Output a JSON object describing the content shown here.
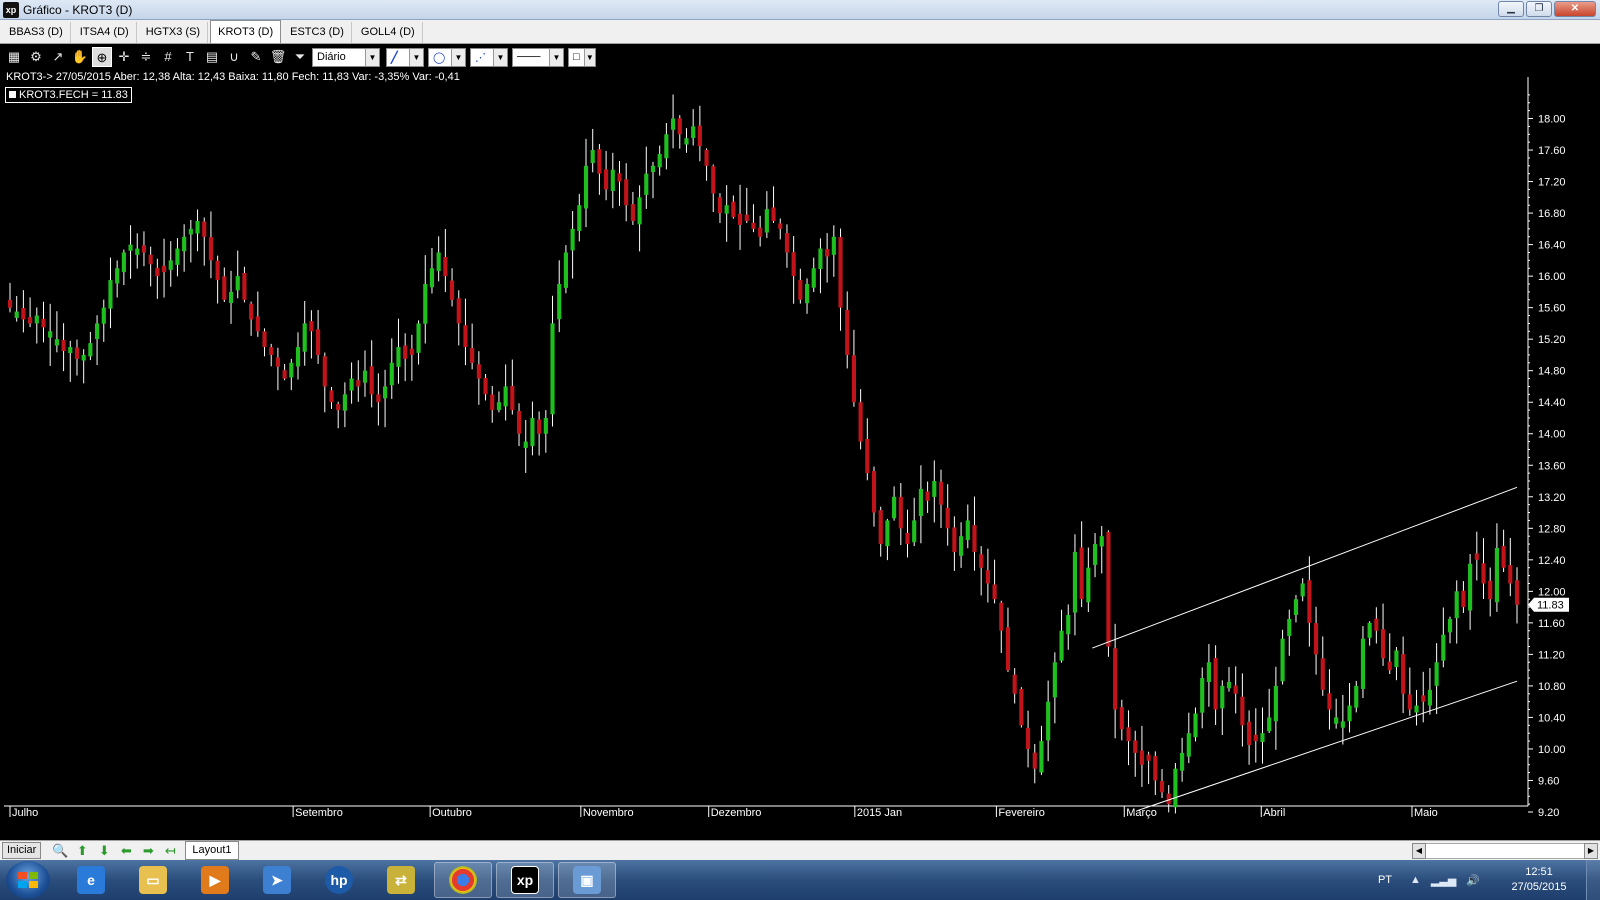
{
  "window": {
    "app_icon": "xp",
    "title": "Gráfico - KROT3 (D)"
  },
  "tabs": [
    "BBAS3 (D)",
    "ITSA4 (D)",
    "HGTX3 (S)",
    "KROT3 (D)",
    "ESTC3 (D)",
    "GOLL4 (D)"
  ],
  "active_tab": "KROT3 (D)",
  "toolbar": {
    "period": "Diário"
  },
  "info_line": "KROT3-> 27/05/2015 Aber: 12,38 Alta: 12,43 Baixa: 11,80 Fech: 11,83 Var: -3,35% Var: -0,41",
  "legend": "KROT3.FECH = 11.83",
  "bottom": {
    "start_label": "Iniciar",
    "layout_tab": "Layout1"
  },
  "taskbar": {
    "language": "PT",
    "time": "12:51",
    "date": "27/05/2015"
  },
  "colors": {
    "up": "#1fbf1f",
    "down": "#c0141a",
    "background": "#000000",
    "text": "#ffffff"
  },
  "chart_data": {
    "type": "candlestick",
    "symbol": "KROT3",
    "last_price": "11.83",
    "ylim": [
      9.2,
      18.4
    ],
    "y_ticks": [
      "18.00",
      "17.60",
      "17.20",
      "16.80",
      "16.40",
      "16.00",
      "15.60",
      "15.20",
      "14.80",
      "14.40",
      "14.00",
      "13.60",
      "13.20",
      "12.80",
      "12.40",
      "12.00",
      "11.60",
      "11.20",
      "10.80",
      "10.40",
      "10.00",
      "9.60",
      "9.20"
    ],
    "month_labels": [
      {
        "label": "Julho",
        "date": "2014-07-01"
      },
      {
        "label": "Setembro",
        "date": "2014-09-01"
      },
      {
        "label": "Outubro",
        "date": "2014-10-01"
      },
      {
        "label": "Novembro",
        "date": "2014-11-03"
      },
      {
        "label": "Dezembro",
        "date": "2014-12-01"
      },
      {
        "label": "2015 Jan",
        "date": "2015-01-02"
      },
      {
        "label": "Fevereiro",
        "date": "2015-02-02"
      },
      {
        "label": "Março",
        "date": "2015-03-02"
      },
      {
        "label": "Abril",
        "date": "2015-04-01"
      },
      {
        "label": "Maio",
        "date": "2015-05-04"
      }
    ],
    "trendlines": [
      {
        "name": "upper channel",
        "from": {
          "date": "2015-02-23",
          "price": 11.28
        },
        "to": {
          "date": "2015-05-27",
          "price": 13.32
        }
      },
      {
        "name": "lower channel",
        "from": {
          "date": "2015-03-05",
          "price": 9.22
        },
        "to": {
          "date": "2015-05-27",
          "price": 10.86
        }
      }
    ],
    "closes_approx": [
      15.6,
      15.55,
      15.45,
      15.4,
      15.5,
      15.35,
      15.3,
      15.2,
      15.05,
      15.1,
      14.95,
      15.0,
      15.15,
      15.4,
      15.6,
      15.95,
      16.1,
      16.3,
      16.4,
      16.35,
      16.3,
      16.15,
      16.0,
      16.05,
      16.2,
      16.35,
      16.5,
      16.6,
      16.7,
      16.5,
      16.2,
      15.95,
      15.7,
      15.8,
      16.0,
      15.7,
      15.45,
      15.3,
      15.1,
      15.0,
      14.85,
      14.7,
      14.9,
      15.1,
      15.4,
      15.3,
      15.0,
      14.6,
      14.4,
      14.3,
      14.5,
      14.7,
      14.6,
      14.8,
      14.5,
      14.4,
      14.6,
      14.9,
      15.1,
      14.95,
      15.0,
      15.4,
      15.9,
      16.1,
      16.3,
      16.0,
      15.7,
      15.4,
      15.1,
      14.9,
      14.7,
      14.5,
      14.3,
      14.4,
      14.6,
      14.3,
      14.0,
      13.9,
      14.2,
      14.0,
      14.2,
      15.4,
      15.9,
      16.3,
      16.6,
      16.9,
      17.4,
      17.6,
      17.3,
      17.1,
      17.35,
      17.2,
      16.9,
      16.7,
      17.0,
      17.3,
      17.4,
      17.55,
      17.8,
      18.0,
      17.8,
      17.75,
      17.9,
      17.65,
      17.4,
      17.05,
      16.8,
      16.9,
      16.75,
      16.65,
      16.7,
      16.6,
      16.5,
      16.85,
      16.7,
      16.6,
      16.3,
      16.0,
      15.7,
      15.9,
      16.1,
      16.35,
      16.25,
      16.5,
      15.6,
      15.0,
      14.4,
      13.9,
      13.5,
      13.0,
      12.6,
      12.9,
      13.2,
      12.8,
      12.6,
      12.9,
      13.3,
      13.15,
      13.4,
      13.1,
      12.8,
      12.5,
      12.7,
      12.9,
      12.5,
      12.3,
      12.1,
      11.9,
      11.5,
      11.0,
      10.7,
      10.3,
      10.0,
      9.75,
      10.1,
      10.6,
      11.1,
      11.5,
      11.7,
      12.5,
      11.9,
      12.3,
      12.6,
      12.7,
      11.3,
      10.5,
      10.25,
      10.1,
      9.95,
      9.8,
      9.85,
      9.6,
      9.45,
      9.3,
      9.75,
      9.95,
      10.2,
      10.45,
      10.9,
      11.1,
      10.5,
      10.8,
      10.85,
      10.7,
      10.3,
      10.05,
      10.1,
      10.2,
      10.4,
      10.8,
      11.4,
      11.65,
      11.9,
      12.1,
      11.6,
      11.2,
      10.75,
      10.5,
      10.4,
      10.35,
      10.55,
      10.8,
      11.4,
      11.6,
      11.5,
      11.15,
      11.0,
      11.25,
      10.7,
      10.5,
      10.55,
      10.6,
      10.75,
      11.1,
      11.45,
      11.65,
      12.0,
      11.8,
      12.35,
      12.4,
      12.1,
      11.9,
      12.55,
      12.3,
      12.1,
      11.83
    ]
  }
}
